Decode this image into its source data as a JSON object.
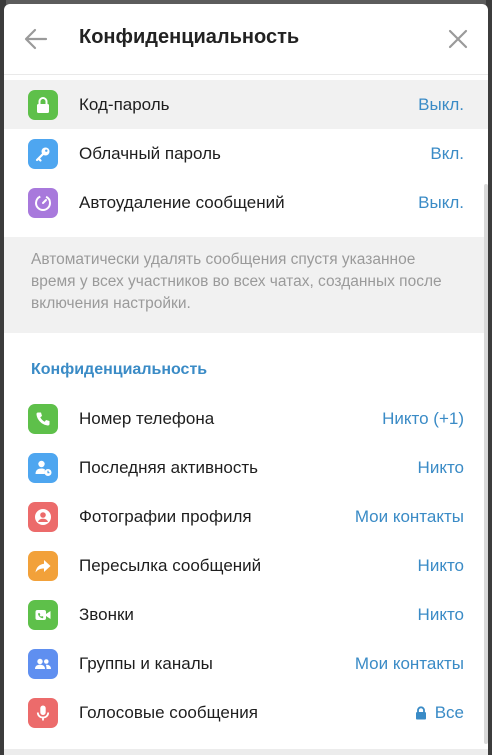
{
  "header": {
    "title": "Конфиденциальность",
    "back_icon": "arrow-left-icon",
    "close_icon": "close-icon"
  },
  "security_rows": [
    {
      "label": "Код-пароль",
      "value": "Выкл.",
      "icon": "lock-icon",
      "color": "#5ec04a"
    },
    {
      "label": "Облачный пароль",
      "value": "Вкл.",
      "icon": "key-icon",
      "color": "#4ea6f0"
    },
    {
      "label": "Автоудаление сообщений",
      "value": "Выкл.",
      "icon": "timer-icon",
      "color": "#a879dc"
    }
  ],
  "autodelete_note": "Автоматически удалять сообщения спустя указанное время у всех участников во всех чатах, созданных после включения настройки.",
  "privacy_section": {
    "title": "Конфиденциальность",
    "rows": [
      {
        "label": "Номер телефона",
        "value": "Никто (+1)",
        "icon": "phone-icon",
        "color": "#5ec04a"
      },
      {
        "label": "Последняя активность",
        "value": "Никто",
        "icon": "user-clock-icon",
        "color": "#4ea6f0"
      },
      {
        "label": "Фотографии профиля",
        "value": "Мои контакты",
        "icon": "profile-photo-icon",
        "color": "#ec6b6b"
      },
      {
        "label": "Пересылка сообщений",
        "value": "Никто",
        "icon": "forward-icon",
        "color": "#f2a13a"
      },
      {
        "label": "Звонки",
        "value": "Никто",
        "icon": "video-call-icon",
        "color": "#5ec04a"
      },
      {
        "label": "Группы и каналы",
        "value": "Мои контакты",
        "icon": "group-icon",
        "color": "#5f8ff0"
      },
      {
        "label": "Голосовые сообщения",
        "value": "Все",
        "icon": "microphone-icon",
        "color": "#ec6b6b",
        "value_icon": "lock-small-icon"
      }
    ]
  },
  "colors": {
    "accent": "#3a8bc6",
    "note_bg": "#f1f1f1"
  }
}
